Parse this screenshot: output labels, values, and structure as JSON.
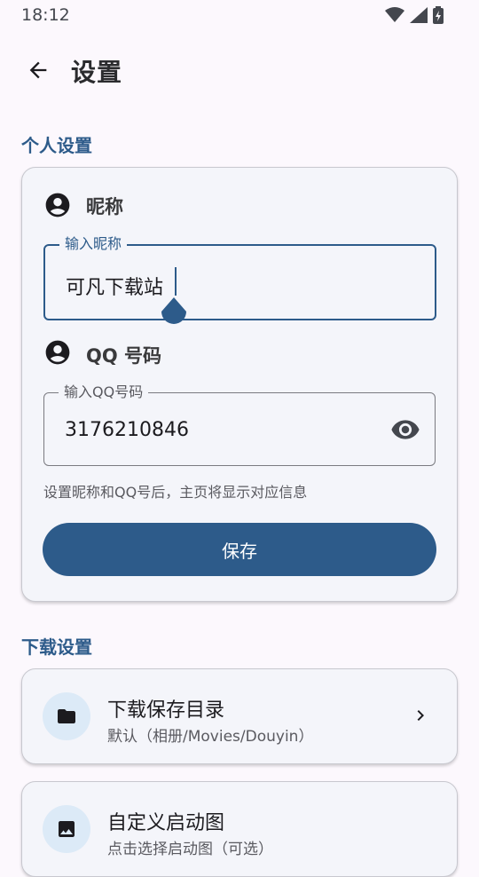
{
  "status": {
    "time": "18:12"
  },
  "topbar": {
    "title": "设置"
  },
  "personal": {
    "section_title": "个人设置",
    "nickname_label": "昵称",
    "nickname_field_label": "输入昵称",
    "nickname_value": "可凡下载站",
    "qq_label": "QQ 号码",
    "qq_field_label": "输入QQ号码",
    "qq_value": "3176210846",
    "hint": "设置昵称和QQ号后，主页将显示对应信息",
    "save_label": "保存"
  },
  "download": {
    "section_title": "下载设置",
    "items": [
      {
        "title": "下载保存目录",
        "subtitle": "默认（相册/Movies/Douyin）"
      },
      {
        "title": "自定义启动图",
        "subtitle": "点击选择启动图（可选）"
      }
    ]
  },
  "colors": {
    "accent": "#2d5b8a",
    "background": "#fcf8fd"
  }
}
